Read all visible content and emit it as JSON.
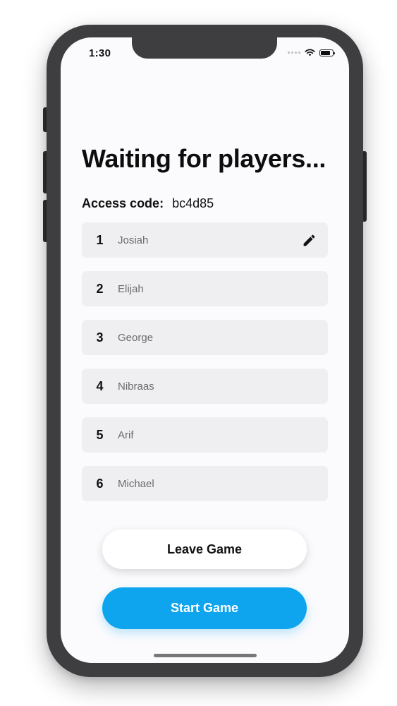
{
  "status_bar": {
    "time": "1:30",
    "wifi_icon": "wifi-icon",
    "battery_icon": "battery-icon"
  },
  "screen": {
    "title": "Waiting for players...",
    "access_code_label": "Access code:",
    "access_code_value": "bc4d85"
  },
  "players": [
    {
      "number": "1",
      "name": "Josiah",
      "editable": true
    },
    {
      "number": "2",
      "name": "Elijah"
    },
    {
      "number": "3",
      "name": "George"
    },
    {
      "number": "4",
      "name": "Nibraas"
    },
    {
      "number": "5",
      "name": "Arif"
    },
    {
      "number": "6",
      "name": "Michael"
    }
  ],
  "actions": {
    "leave_label": "Leave Game",
    "start_label": "Start Game"
  },
  "colors": {
    "accent": "#0ea5ee",
    "row_background": "#efeff1",
    "screen_background": "#fbfbfd",
    "phone_frame": "#3e3e40"
  },
  "icons": {
    "edit": "pencil-icon"
  }
}
